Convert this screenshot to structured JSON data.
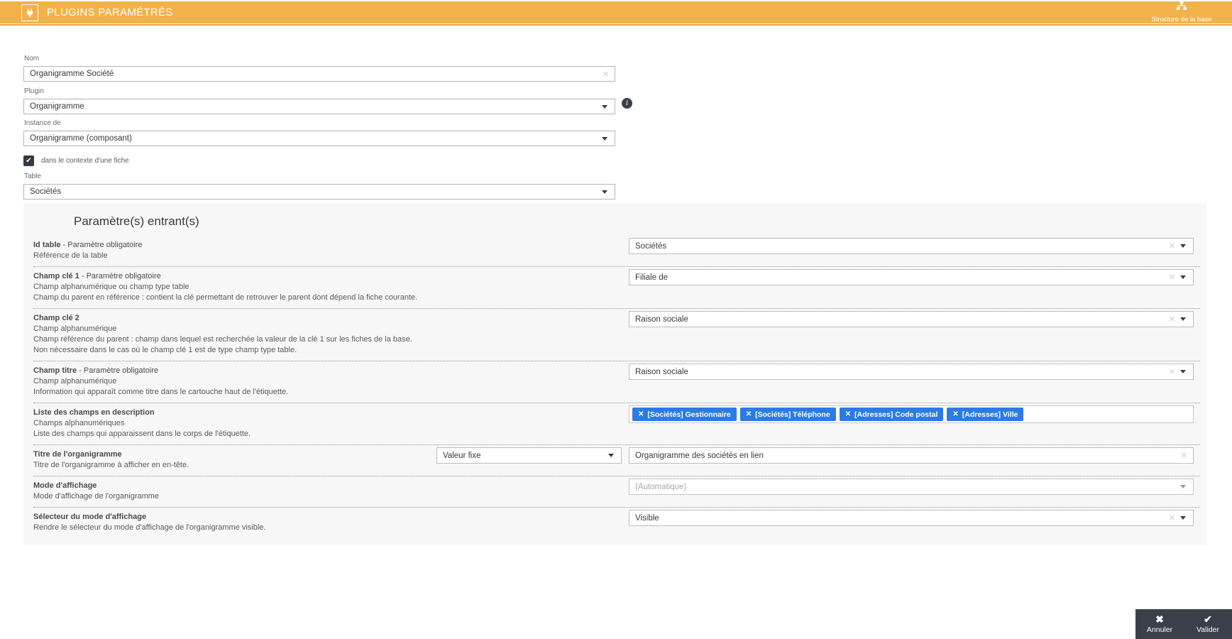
{
  "header": {
    "title": "PLUGINS PARAMÉTRÉS",
    "structure_button": {
      "label": "Structure de la base"
    }
  },
  "icons": {
    "checkbox_check": "✔",
    "clear": "✕",
    "chip_remove": "✕",
    "info": "i",
    "cancel": "✖",
    "validate": "✔"
  },
  "colors": {
    "header_bar": "#F2B24A",
    "header_underline": "#EAA23C",
    "chip_blue": "#2B7BE4",
    "footer_dark": "#3A4049",
    "panel_gray": "#F7F7F7",
    "checkbox_dark": "#343A42"
  },
  "form": {
    "nom": {
      "label": "Nom",
      "value": "Organigramme Société"
    },
    "plugin": {
      "label": "Plugin",
      "value": "Organigramme"
    },
    "instance": {
      "label": "Instance de",
      "value": "Organigramme (composant)"
    },
    "context_checkbox": {
      "label": "dans le contexte d'une fiche",
      "checked": true
    },
    "table": {
      "label": "Table",
      "value": "Sociétés"
    }
  },
  "params": {
    "title": "Paramètre(s) entrant(s)",
    "rows": [
      {
        "name": "Id table",
        "suffix": " - Paramètre obligatoire",
        "descriptions": [
          "Référence de la table"
        ],
        "value": "Sociétés"
      },
      {
        "name": "Champ clé 1",
        "suffix": " - Paramètre obligatoire",
        "descriptions": [
          "Champ alphanumérique ou champ type table",
          "Champ du parent en référence : contient la clé permettant de retrouver le parent dont dépend la fiche courante."
        ],
        "value": "Filiale de"
      },
      {
        "name": "Champ clé 2",
        "suffix": "",
        "descriptions": [
          "Champ alphanumérique",
          "Champ référence du parent : champ dans lequel est recherchée la valeur de la clé 1 sur les fiches de la base.",
          "Non nécessaire dans le cas où le champ clé 1 est de type champ type table."
        ],
        "value": "Raison sociale"
      },
      {
        "name": "Champ titre",
        "suffix": " - Paramètre obligatoire",
        "descriptions": [
          "Champ alphanumérique",
          "Information qui apparaît comme titre dans le cartouche haut de l'étiquette."
        ],
        "value": "Raison sociale"
      },
      {
        "name": "Liste des champs en description",
        "suffix": "",
        "descriptions": [
          "Champs alphanumériques",
          "Liste des champs qui apparaissent dans le corps de l'étiquette."
        ],
        "chips": [
          "[Sociétés] Gestionnaire",
          "[Sociétés] Téléphone",
          "[Adresses] Code postal",
          "[Adresses] Ville"
        ]
      },
      {
        "name": "Titre de l'organigramme",
        "suffix": "",
        "descriptions": [
          "Titre de l'organigramme à afficher en en-tête."
        ],
        "mode_value": "Valeur fixe",
        "text_value": "Organigramme des sociétés en lien"
      },
      {
        "name": "Mode d'affichage",
        "suffix": "",
        "descriptions": [
          "Mode d'affichage de l'organigramme"
        ],
        "value": "(Automatique)"
      },
      {
        "name": "Sélecteur du mode d'affichage",
        "suffix": "",
        "descriptions": [
          "Rendre le sélecteur du mode d'affichage de l'organigramme visible."
        ],
        "value": "Visible"
      }
    ]
  },
  "footer": {
    "cancel_label": "Annuler",
    "validate_label": "Valider"
  }
}
